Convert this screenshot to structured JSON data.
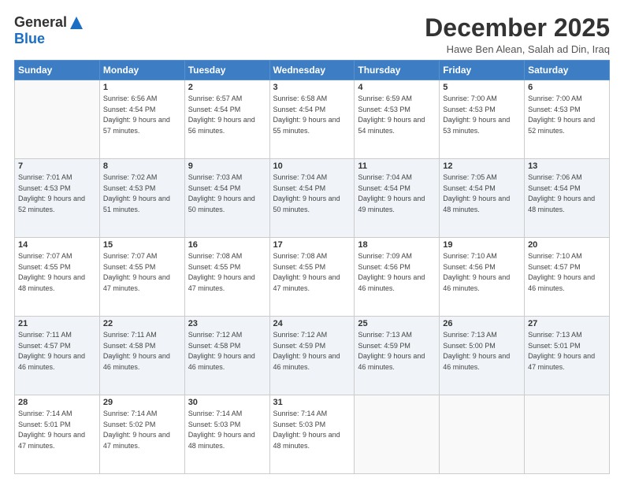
{
  "header": {
    "logo_general": "General",
    "logo_blue": "Blue",
    "month_title": "December 2025",
    "location": "Hawe Ben Alean, Salah ad Din, Iraq"
  },
  "days_of_week": [
    "Sunday",
    "Monday",
    "Tuesday",
    "Wednesday",
    "Thursday",
    "Friday",
    "Saturday"
  ],
  "weeks": [
    [
      {
        "day": "",
        "sunrise": "",
        "sunset": "",
        "daylight": ""
      },
      {
        "day": "1",
        "sunrise": "Sunrise: 6:56 AM",
        "sunset": "Sunset: 4:54 PM",
        "daylight": "Daylight: 9 hours and 57 minutes."
      },
      {
        "day": "2",
        "sunrise": "Sunrise: 6:57 AM",
        "sunset": "Sunset: 4:54 PM",
        "daylight": "Daylight: 9 hours and 56 minutes."
      },
      {
        "day": "3",
        "sunrise": "Sunrise: 6:58 AM",
        "sunset": "Sunset: 4:54 PM",
        "daylight": "Daylight: 9 hours and 55 minutes."
      },
      {
        "day": "4",
        "sunrise": "Sunrise: 6:59 AM",
        "sunset": "Sunset: 4:53 PM",
        "daylight": "Daylight: 9 hours and 54 minutes."
      },
      {
        "day": "5",
        "sunrise": "Sunrise: 7:00 AM",
        "sunset": "Sunset: 4:53 PM",
        "daylight": "Daylight: 9 hours and 53 minutes."
      },
      {
        "day": "6",
        "sunrise": "Sunrise: 7:00 AM",
        "sunset": "Sunset: 4:53 PM",
        "daylight": "Daylight: 9 hours and 52 minutes."
      }
    ],
    [
      {
        "day": "7",
        "sunrise": "Sunrise: 7:01 AM",
        "sunset": "Sunset: 4:53 PM",
        "daylight": "Daylight: 9 hours and 52 minutes."
      },
      {
        "day": "8",
        "sunrise": "Sunrise: 7:02 AM",
        "sunset": "Sunset: 4:53 PM",
        "daylight": "Daylight: 9 hours and 51 minutes."
      },
      {
        "day": "9",
        "sunrise": "Sunrise: 7:03 AM",
        "sunset": "Sunset: 4:54 PM",
        "daylight": "Daylight: 9 hours and 50 minutes."
      },
      {
        "day": "10",
        "sunrise": "Sunrise: 7:04 AM",
        "sunset": "Sunset: 4:54 PM",
        "daylight": "Daylight: 9 hours and 50 minutes."
      },
      {
        "day": "11",
        "sunrise": "Sunrise: 7:04 AM",
        "sunset": "Sunset: 4:54 PM",
        "daylight": "Daylight: 9 hours and 49 minutes."
      },
      {
        "day": "12",
        "sunrise": "Sunrise: 7:05 AM",
        "sunset": "Sunset: 4:54 PM",
        "daylight": "Daylight: 9 hours and 48 minutes."
      },
      {
        "day": "13",
        "sunrise": "Sunrise: 7:06 AM",
        "sunset": "Sunset: 4:54 PM",
        "daylight": "Daylight: 9 hours and 48 minutes."
      }
    ],
    [
      {
        "day": "14",
        "sunrise": "Sunrise: 7:07 AM",
        "sunset": "Sunset: 4:55 PM",
        "daylight": "Daylight: 9 hours and 48 minutes."
      },
      {
        "day": "15",
        "sunrise": "Sunrise: 7:07 AM",
        "sunset": "Sunset: 4:55 PM",
        "daylight": "Daylight: 9 hours and 47 minutes."
      },
      {
        "day": "16",
        "sunrise": "Sunrise: 7:08 AM",
        "sunset": "Sunset: 4:55 PM",
        "daylight": "Daylight: 9 hours and 47 minutes."
      },
      {
        "day": "17",
        "sunrise": "Sunrise: 7:08 AM",
        "sunset": "Sunset: 4:55 PM",
        "daylight": "Daylight: 9 hours and 47 minutes."
      },
      {
        "day": "18",
        "sunrise": "Sunrise: 7:09 AM",
        "sunset": "Sunset: 4:56 PM",
        "daylight": "Daylight: 9 hours and 46 minutes."
      },
      {
        "day": "19",
        "sunrise": "Sunrise: 7:10 AM",
        "sunset": "Sunset: 4:56 PM",
        "daylight": "Daylight: 9 hours and 46 minutes."
      },
      {
        "day": "20",
        "sunrise": "Sunrise: 7:10 AM",
        "sunset": "Sunset: 4:57 PM",
        "daylight": "Daylight: 9 hours and 46 minutes."
      }
    ],
    [
      {
        "day": "21",
        "sunrise": "Sunrise: 7:11 AM",
        "sunset": "Sunset: 4:57 PM",
        "daylight": "Daylight: 9 hours and 46 minutes."
      },
      {
        "day": "22",
        "sunrise": "Sunrise: 7:11 AM",
        "sunset": "Sunset: 4:58 PM",
        "daylight": "Daylight: 9 hours and 46 minutes."
      },
      {
        "day": "23",
        "sunrise": "Sunrise: 7:12 AM",
        "sunset": "Sunset: 4:58 PM",
        "daylight": "Daylight: 9 hours and 46 minutes."
      },
      {
        "day": "24",
        "sunrise": "Sunrise: 7:12 AM",
        "sunset": "Sunset: 4:59 PM",
        "daylight": "Daylight: 9 hours and 46 minutes."
      },
      {
        "day": "25",
        "sunrise": "Sunrise: 7:13 AM",
        "sunset": "Sunset: 4:59 PM",
        "daylight": "Daylight: 9 hours and 46 minutes."
      },
      {
        "day": "26",
        "sunrise": "Sunrise: 7:13 AM",
        "sunset": "Sunset: 5:00 PM",
        "daylight": "Daylight: 9 hours and 46 minutes."
      },
      {
        "day": "27",
        "sunrise": "Sunrise: 7:13 AM",
        "sunset": "Sunset: 5:01 PM",
        "daylight": "Daylight: 9 hours and 47 minutes."
      }
    ],
    [
      {
        "day": "28",
        "sunrise": "Sunrise: 7:14 AM",
        "sunset": "Sunset: 5:01 PM",
        "daylight": "Daylight: 9 hours and 47 minutes."
      },
      {
        "day": "29",
        "sunrise": "Sunrise: 7:14 AM",
        "sunset": "Sunset: 5:02 PM",
        "daylight": "Daylight: 9 hours and 47 minutes."
      },
      {
        "day": "30",
        "sunrise": "Sunrise: 7:14 AM",
        "sunset": "Sunset: 5:03 PM",
        "daylight": "Daylight: 9 hours and 48 minutes."
      },
      {
        "day": "31",
        "sunrise": "Sunrise: 7:14 AM",
        "sunset": "Sunset: 5:03 PM",
        "daylight": "Daylight: 9 hours and 48 minutes."
      },
      {
        "day": "",
        "sunrise": "",
        "sunset": "",
        "daylight": ""
      },
      {
        "day": "",
        "sunrise": "",
        "sunset": "",
        "daylight": ""
      },
      {
        "day": "",
        "sunrise": "",
        "sunset": "",
        "daylight": ""
      }
    ]
  ]
}
